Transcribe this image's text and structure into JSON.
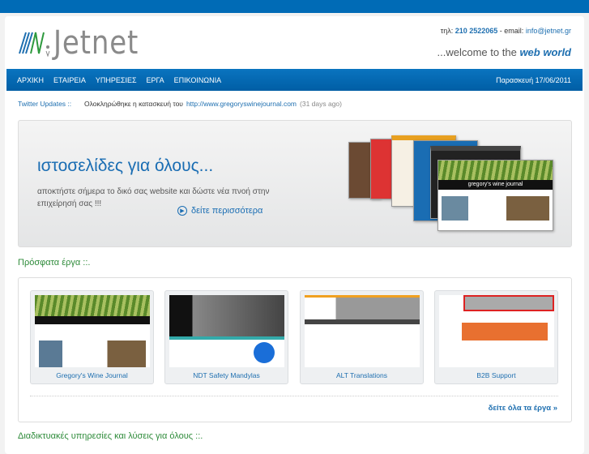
{
  "header": {
    "logo": "Jetnet",
    "phone_label": "τηλ:",
    "phone": "210 2522065",
    "email_label": "- email:",
    "email": "info@jetnet.gr",
    "welcome": "...welcome to the",
    "welcome_em": "web world"
  },
  "nav": {
    "items": [
      "ΑΡΧΙΚΗ",
      "ΕΤΑΙΡΕΙΑ",
      "ΥΠΗΡΕΣΙΕΣ",
      "ΕΡΓΑ",
      "ΕΠΙΚΟΙΝΩΝΙΑ"
    ],
    "date": "Παρασκευή 17/06/2011"
  },
  "twitter": {
    "label": "Twitter Updates ::",
    "text": "Ολοκληρώθηκε η κατασκευή του",
    "link": "http://www.gregoryswinejournal.com",
    "ago": "(31 days ago)"
  },
  "banner": {
    "title": "ιστοσελίδες για όλους...",
    "text": "αποκτήστε σήμερα το δικό σας website και δώστε νέα πνοή στην επιχείρησή σας !!!",
    "more": "δείτε περισσότερα",
    "showcase_title": "gregory's wine journal"
  },
  "recent": {
    "heading": "Πρόσφατα έργα ::.",
    "projects": [
      {
        "name": "Gregory's Wine Journal"
      },
      {
        "name": "NDT Safety Mandylas"
      },
      {
        "name": "ALT Translations"
      },
      {
        "name": "B2B Support"
      }
    ],
    "all_link": "δείτε όλα τα έργα »"
  },
  "services": {
    "heading": "Διαδικτυακές υπηρεσίες και λύσεις για όλους ::."
  },
  "colors": {
    "brand": "#006bb6",
    "green": "#2e8b3a"
  }
}
